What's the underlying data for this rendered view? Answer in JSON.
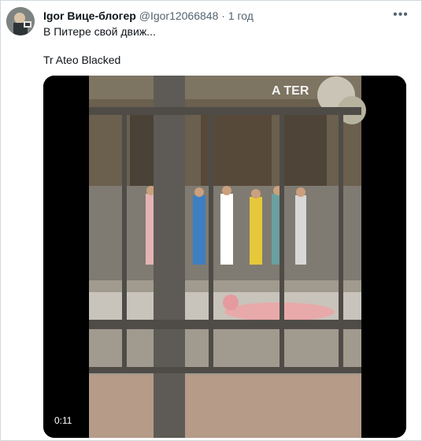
{
  "tweet": {
    "author_name": "Igor Вице-блогер",
    "author_handle": "@Igor12066848",
    "separator": "·",
    "time": "1 год",
    "text_line1": "В Питере свой движ...",
    "text_line2": "Tr Ateo Blacked"
  },
  "video": {
    "duration": "0:11",
    "sign_text": "A TER"
  },
  "icons": {
    "more": "more-horizontal-icon",
    "avatar": "avatar-image"
  },
  "colors": {
    "text": "#0f1419",
    "secondary_text": "#536471",
    "border": "#cfd9de",
    "video_bg": "#000000"
  }
}
